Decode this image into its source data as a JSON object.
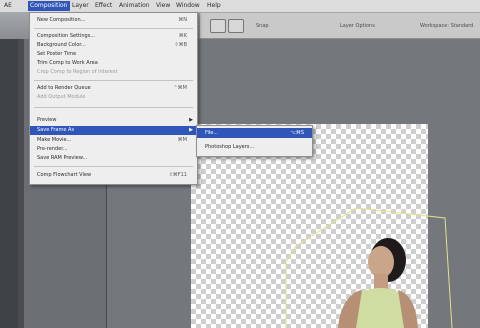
{
  "menubar": {
    "items": [
      {
        "label": "AE",
        "active": false
      },
      {
        "label": "Composition",
        "active": true
      },
      {
        "label": "Layer",
        "active": false
      },
      {
        "label": "Effect",
        "active": false
      },
      {
        "label": "Animation",
        "active": false
      },
      {
        "label": "View",
        "active": false
      },
      {
        "label": "Window",
        "active": false
      },
      {
        "label": "Help",
        "active": false
      }
    ]
  },
  "toolbar": {
    "text_1": "Snap",
    "text_2": "Layer Options",
    "text_3": "Workspace: Standard"
  },
  "composition_menu": {
    "items": [
      {
        "label": "New Composition...",
        "shortcut": "⌘N"
      },
      {
        "label": "Composition Settings...",
        "shortcut": "⌘K"
      },
      {
        "label": "Background Color...",
        "shortcut": "⇧⌘B"
      },
      {
        "label": "Set Poster Time",
        "shortcut": ""
      },
      {
        "label": "Trim Comp to Work Area",
        "shortcut": ""
      },
      {
        "label": "Crop Comp to Region of Interest",
        "shortcut": "",
        "disabled": true
      },
      {
        "label": "Add to Render Queue",
        "shortcut": "⌃⌘M"
      },
      {
        "label": "Add Output Module",
        "shortcut": "",
        "disabled": true
      },
      {
        "label": "Preview",
        "shortcut": "",
        "submenu": true
      },
      {
        "label": "Save Frame As",
        "shortcut": "",
        "active": true,
        "submenu": true
      },
      {
        "label": "Make Movie...",
        "shortcut": "⌘M"
      },
      {
        "label": "Pre-render...",
        "shortcut": ""
      },
      {
        "label": "Save RAM Preview...",
        "shortcut": ""
      },
      {
        "label": "Comp Flowchart View",
        "shortcut": "⇧⌘F11"
      }
    ]
  },
  "save_frame_submenu": {
    "items": [
      {
        "label": "File...",
        "shortcut": "⌥⌘S",
        "active": true
      },
      {
        "label": "Photoshop Layers...",
        "shortcut": ""
      }
    ]
  },
  "colors": {
    "highlight": "#2f56b8"
  }
}
